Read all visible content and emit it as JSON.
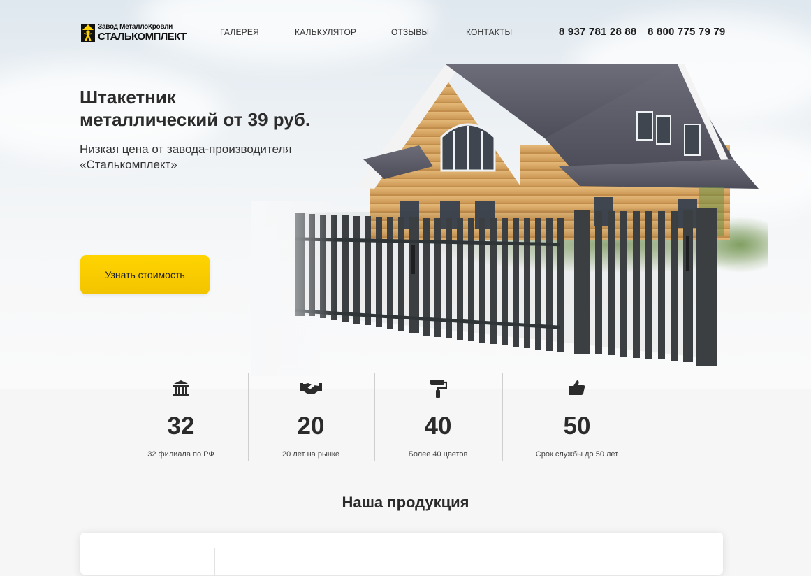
{
  "brand": {
    "line1": "Завод МеталлоКровли",
    "line2": "СТАЛЬКОМПЛЕКТ",
    "icon": "logo-house-person-icon"
  },
  "nav": {
    "items": [
      {
        "label": "ГАЛЕРЕЯ"
      },
      {
        "label": "КАЛЬКУЛЯТОР"
      },
      {
        "label": "ОТЗЫВЫ"
      },
      {
        "label": "КОНТАКТЫ"
      }
    ]
  },
  "contacts": {
    "phone1": "8 937 781 28 88",
    "phone2": "8 800 775 79 79"
  },
  "hero": {
    "title_line1": "Штакетник",
    "title_line2": "металлический от 39 руб.",
    "subtitle_line1": "Низкая цена от завода-производителя",
    "subtitle_line2": "«Сталькомплект»",
    "cta_label": "Узнать стоимость",
    "image": "log-house-with-metal-picket-fence"
  },
  "stats": [
    {
      "icon": "bank-building-icon",
      "value": "32",
      "label": "32 филиала по РФ"
    },
    {
      "icon": "handshake-icon",
      "value": "20",
      "label": "20 лет на рынке"
    },
    {
      "icon": "paint-roller-icon",
      "value": "40",
      "label": "Более 40 цветов"
    },
    {
      "icon": "thumbs-up-icon",
      "value": "50",
      "label": "Срок службы до 50 лет"
    }
  ],
  "products": {
    "title": "Наша продукция"
  },
  "colors": {
    "accent": "#ffd400",
    "text": "#2b2b2b",
    "fence": "#3b3f42",
    "roof": "#5a5a66",
    "wood": "#d9aa66"
  }
}
